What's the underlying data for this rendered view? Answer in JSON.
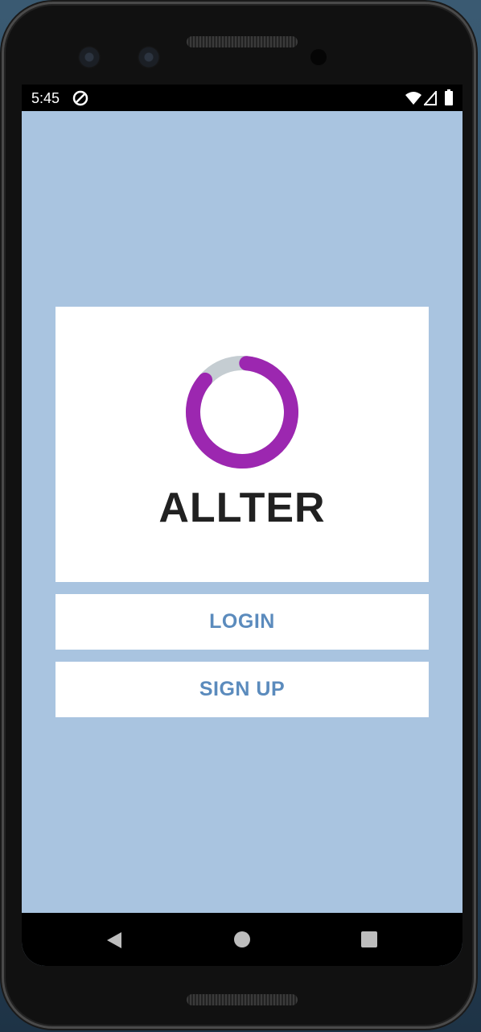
{
  "status_bar": {
    "time": "5:45"
  },
  "app": {
    "name": "ALLTER",
    "logo": {
      "ring_progress_percent": 85,
      "ring_color": "#9c27b0",
      "ring_track_color": "#c5cdd2"
    }
  },
  "actions": {
    "login_label": "LOGIN",
    "signup_label": "SIGN UP"
  },
  "theme": {
    "background": "#a9c4e0",
    "button_text": "#5b8bbd",
    "title_text": "#212121"
  },
  "icons": {
    "status": [
      "notification-icon",
      "wifi-icon",
      "signal-icon",
      "battery-icon"
    ],
    "navigation": [
      "back-icon",
      "home-icon",
      "recents-icon"
    ]
  }
}
